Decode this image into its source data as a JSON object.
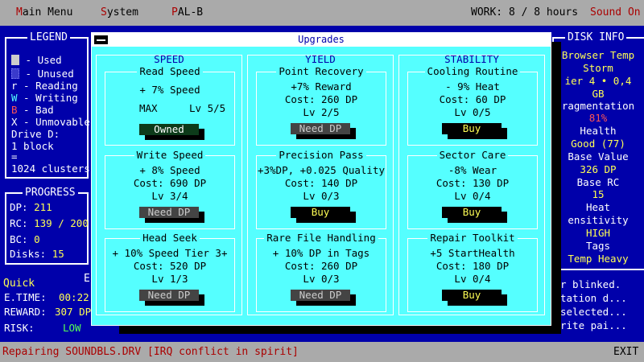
{
  "menubar": {
    "main_menu_hot": "M",
    "main_menu_rest": "ain Menu",
    "system_hot": "S",
    "system_rest": "ystem",
    "pal_hot": "P",
    "pal_rest": "AL-B",
    "work": "WORK: 8 / 8 hours",
    "sound": "Sound On"
  },
  "legend": {
    "title": "LEGEND",
    "items": [
      {
        "symbol": "",
        "label": " - Used"
      },
      {
        "symbol": "",
        "label": " - Unused"
      },
      {
        "symbol": "r",
        "label": " - Reading"
      },
      {
        "symbol": "W",
        "label": " - Writing"
      },
      {
        "symbol": "B",
        "label": " - Bad"
      },
      {
        "symbol": "X",
        "label": " - Unmovable"
      }
    ],
    "drive": "Drive D:",
    "block": "1 block",
    "equals": "=",
    "clusters": "1024 clusters"
  },
  "progress": {
    "title": "PROGRESS",
    "dp_label": "DP:",
    "dp_value": "211",
    "rc_label": "RC:",
    "rc_value": "139 / 200",
    "bc_label": "BC:",
    "bc_value": "0",
    "disks_label": "Disks:",
    "disks_value": "15"
  },
  "quick": {
    "title": "Quick",
    "title_tail": "E",
    "etime_label": "E.TIME:",
    "etime_value": "00:22",
    "reward_label": "REWARD:",
    "reward_value": "307 DP",
    "risk_label": "RISK:",
    "risk_value": "LOW"
  },
  "disk_info": {
    "title": "DISK INFO",
    "rows": [
      "Browser Temp",
      "Storm",
      "ier 4 • 0,4",
      "GB",
      "ragmentation",
      "81%",
      "Health",
      "Good (77)",
      "Base Value",
      "326 DP",
      "Base RC",
      "15",
      "Heat",
      "ensitivity",
      "HIGH",
      "Tags",
      "Temp Heavy"
    ]
  },
  "log": {
    "lines": [
      "r blinked.",
      "tation d...",
      "selected...",
      "rite pai..."
    ]
  },
  "dialog": {
    "title": "Upgrades",
    "columns": [
      {
        "title": "SPEED",
        "cards": [
          {
            "title": "Read Speed",
            "effect": "+ 7% Speed",
            "max": "MAX",
            "level": "Lv 5/5",
            "button": "Owned",
            "state": "owned"
          },
          {
            "title": "Write Speed",
            "effect": "+ 8% Speed",
            "cost": "Cost: 690 DP",
            "level": "Lv 3/4",
            "button": "Need DP",
            "state": "need"
          },
          {
            "title": "Head Seek",
            "effect": "+ 10% Speed Tier 3+",
            "cost": "Cost: 520 DP",
            "level": "Lv 1/3",
            "button": "Need DP",
            "state": "need"
          }
        ]
      },
      {
        "title": "YIELD",
        "cards": [
          {
            "title": "Point Recovery",
            "effect": "+7% Reward",
            "cost": "Cost: 260 DP",
            "level": "Lv 2/5",
            "button": "Need DP",
            "state": "need"
          },
          {
            "title": "Precision Pass",
            "effect": "+3%DP, +0.025 Quality",
            "cost": "Cost: 140 DP",
            "level": "Lv 0/3",
            "button": "Buy",
            "state": "buy"
          },
          {
            "title": "Rare File Handling",
            "effect": "+ 10% DP in Tags",
            "cost": "Cost: 260 DP",
            "level": "Lv 0/3",
            "button": "Need DP",
            "state": "need"
          }
        ]
      },
      {
        "title": "STABILITY",
        "cards": [
          {
            "title": "Cooling Routine",
            "effect": "- 9% Heat",
            "cost": "Cost: 60 DP",
            "level": "Lv 0/5",
            "button": "Buy",
            "state": "buy"
          },
          {
            "title": "Sector Care",
            "effect": "-8% Wear",
            "cost": "Cost: 130 DP",
            "level": "Lv 0/4",
            "button": "Buy",
            "state": "buy"
          },
          {
            "title": "Repair Toolkit",
            "effect": "+5 StartHealth",
            "cost": "Cost: 180 DP",
            "level": "Lv 0/4",
            "button": "Buy",
            "state": "buy"
          }
        ]
      }
    ]
  },
  "status": {
    "message": "Repairing SOUNDBLS.DRV [IRQ conflict in spirit]",
    "exit": "EXIT"
  }
}
